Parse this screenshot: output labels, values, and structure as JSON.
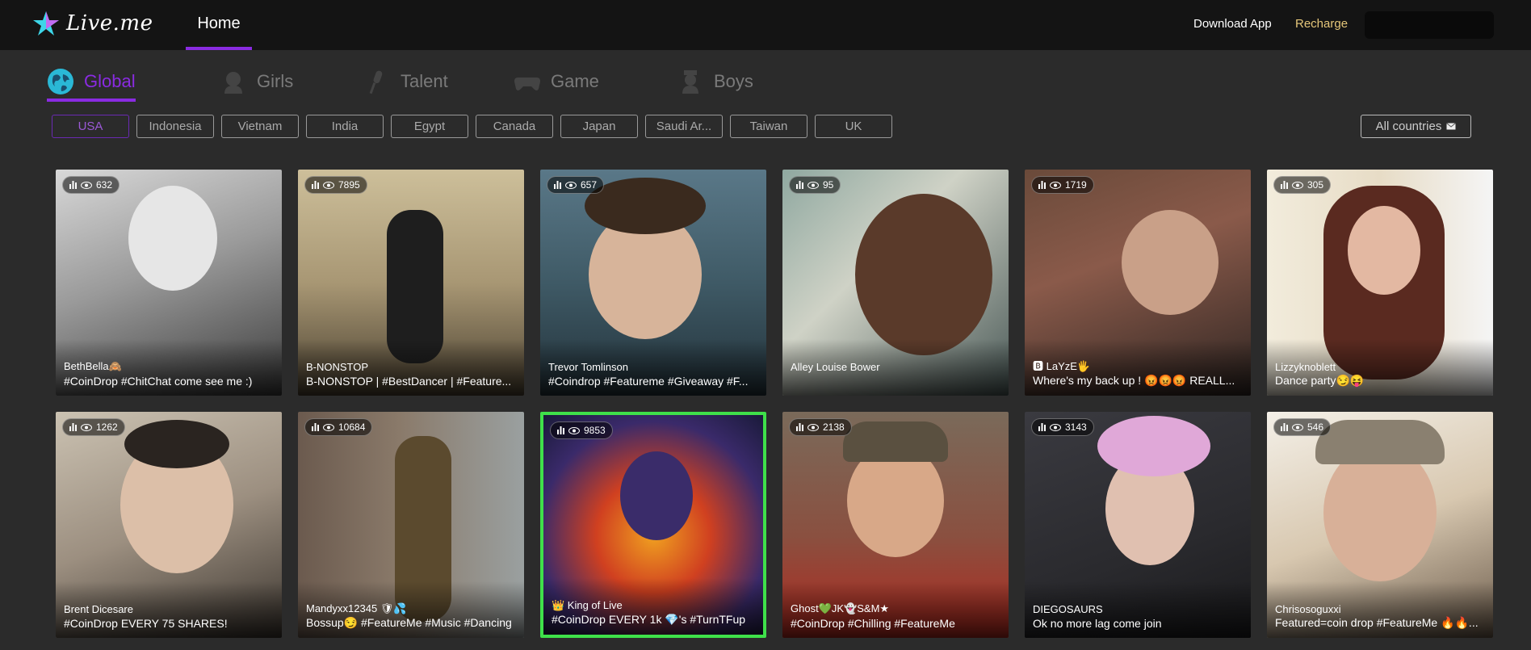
{
  "header": {
    "logo_text": "Live.me",
    "nav_home": "Home",
    "download_app": "Download App",
    "recharge": "Recharge"
  },
  "categories": [
    {
      "label": "Global",
      "icon": "globe-icon",
      "active": true
    },
    {
      "label": "Girls",
      "icon": "girl-icon",
      "active": false
    },
    {
      "label": "Talent",
      "icon": "microphone-icon",
      "active": false
    },
    {
      "label": "Game",
      "icon": "gamepad-icon",
      "active": false
    },
    {
      "label": "Boys",
      "icon": "boy-icon",
      "active": false
    }
  ],
  "countries": [
    "USA",
    "Indonesia",
    "Vietnam",
    "India",
    "Egypt",
    "Canada",
    "Japan",
    "Saudi Ar...",
    "Taiwan",
    "UK"
  ],
  "active_country": "USA",
  "all_countries": "All countries",
  "colors": {
    "accent": "#8a2be2",
    "recharge": "#e6c77a",
    "highlight": "#3fe04a"
  },
  "streams": [
    {
      "viewers": "632",
      "name": "BethBella🙈",
      "title": "#CoinDrop #ChitChat come see me :)"
    },
    {
      "viewers": "7895",
      "name": "B-NONSTOP",
      "title": "B-NONSTOP | #BestDancer | #Feature..."
    },
    {
      "viewers": "657",
      "name": "Trevor Tomlinson",
      "title": "#Coindrop #Featureme #Giveaway #F..."
    },
    {
      "viewers": "95",
      "name": "Alley Louise Bower",
      "title": ""
    },
    {
      "viewers": "1719",
      "name": "🅱 LaYzE🖐",
      "title": "Where's my back up ! 😡😡😡 REALL..."
    },
    {
      "viewers": "305",
      "name": "Lizzyknoblett",
      "title": "Dance party😏😝"
    },
    {
      "viewers": "1262",
      "name": "Brent Dicesare",
      "title": "#CoinDrop EVERY 75 SHARES!"
    },
    {
      "viewers": "10684",
      "name": "Mandyxx12345 🛡💦",
      "title": "Bossup😏 #FeatureMe #Music #Dancing"
    },
    {
      "viewers": "9853",
      "name": "👑 King of Live",
      "title": "#CoinDrop EVERY 1k 💎's #TurnTFup"
    },
    {
      "viewers": "2138",
      "name": "Ghost💚JK👻S&M★",
      "title": "#CoinDrop #Chilling #FeatureMe"
    },
    {
      "viewers": "3143",
      "name": "DIEGOSAURS",
      "title": "Ok no more lag come join"
    },
    {
      "viewers": "546",
      "name": "Chrisosoguxxi",
      "title": "Featured=coin drop #FeatureMe 🔥🔥..."
    }
  ]
}
